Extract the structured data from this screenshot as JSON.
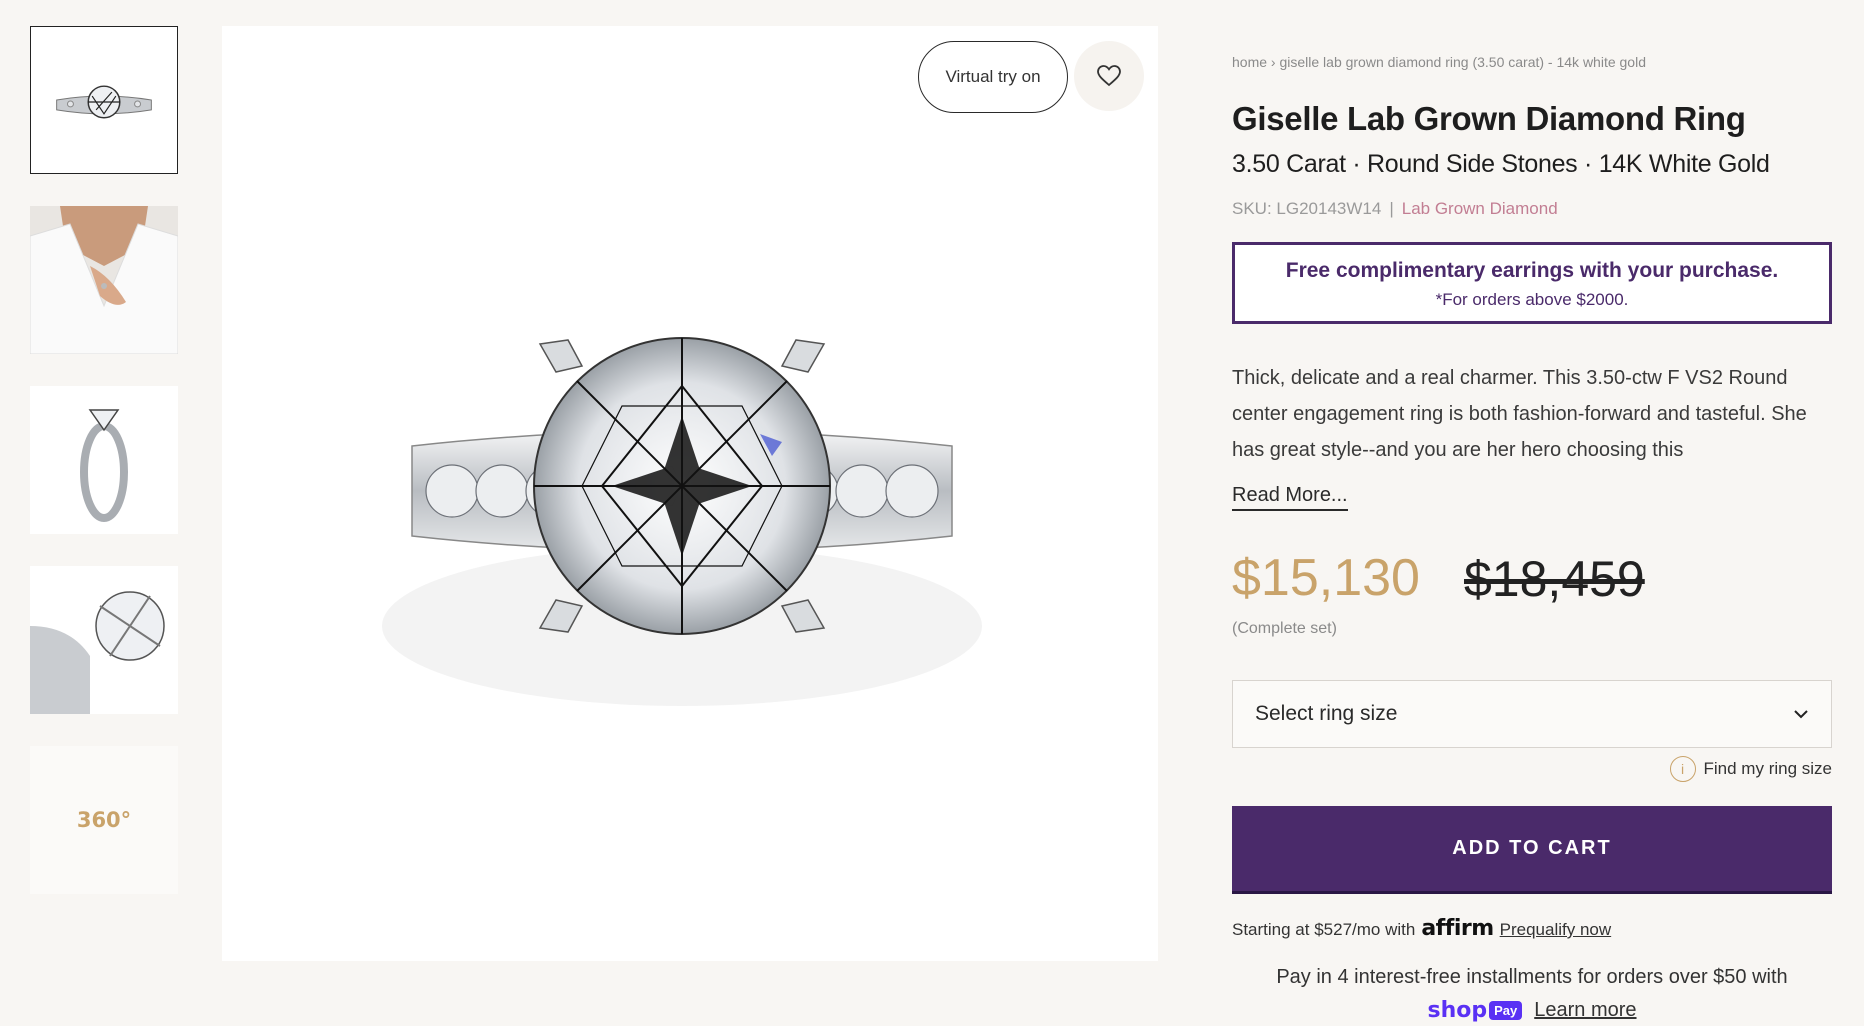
{
  "thumbnails": [
    {
      "kind": "ring-front",
      "active": true
    },
    {
      "kind": "model-wearing",
      "active": false
    },
    {
      "kind": "ring-side",
      "active": false
    },
    {
      "kind": "ring-closeup",
      "active": false
    },
    {
      "kind": "360",
      "label": "360°",
      "active": false
    }
  ],
  "main": {
    "virtual_try_on_label": "Virtual try on",
    "wishlist_icon": "heart-icon"
  },
  "product": {
    "breadcrumb": "home › giselle lab grown diamond ring (3.50 carat) - 14k white gold",
    "title": "Giselle Lab Grown Diamond Ring",
    "subtitle": "3.50 Carat · Round Side Stones · 14K White Gold",
    "sku": "SKU: LG20143W14",
    "sku_separator": "|",
    "type": "Lab Grown Diamond",
    "promo_title": "Free complimentary earrings with your purchase.",
    "promo_note": "*For orders above $2000.",
    "description": "Thick, delicate and a real charmer. This 3.50-ctw F VS2 Round center engagement ring is both fashion-forward and tasteful. She has great style--and you are her hero choosing this",
    "read_more": "Read More...",
    "price": "$15,130",
    "old_price": "$18,459",
    "price_note": "(Complete set)",
    "size_select_placeholder": "Select ring size",
    "find_size_label": "Find my ring size",
    "add_to_cart": "ADD TO CART",
    "affirm_prefix": "Starting at $527/mo with",
    "affirm_brand": "affirm",
    "affirm_link": "Prequalify now",
    "shop_pay_text": "Pay in 4 interest-free installments for orders over $50 with",
    "shop_pay_logo": "shop",
    "shop_pay_badge": "Pay",
    "shop_pay_link": "Learn more"
  },
  "colors": {
    "accent_purple": "#4a2a6a",
    "gold": "#c9a36a",
    "pink": "#c27e93",
    "background": "#f8f6f3"
  }
}
